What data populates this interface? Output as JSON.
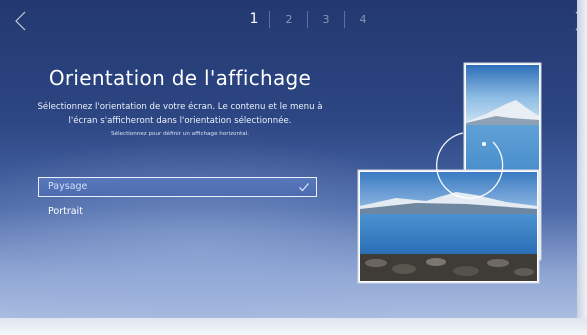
{
  "nav": {
    "back_icon": "chevron-left-icon",
    "next_icon": "chevron-right-icon"
  },
  "steps": {
    "items": [
      "1",
      "2",
      "3",
      "4"
    ],
    "current": 1
  },
  "page": {
    "title": "Orientation de l'affichage",
    "description_line1": "Sélectionnez l'orientation de votre écran. Le contenu et le menu à",
    "description_line2": "l'écran s'afficheront dans l'orientation sélectionnée.",
    "hint": "Sélectionnez pour définir un affichage horizontal."
  },
  "options": {
    "landscape": "Paysage",
    "portrait": "Portrait",
    "selected": "Paysage"
  },
  "illustration": {
    "icon": "rotate-orientation-icon"
  },
  "colors": {
    "background_top": "#23386f",
    "selected_border": "#e8eefb",
    "selected_fill": "#5878bb"
  }
}
